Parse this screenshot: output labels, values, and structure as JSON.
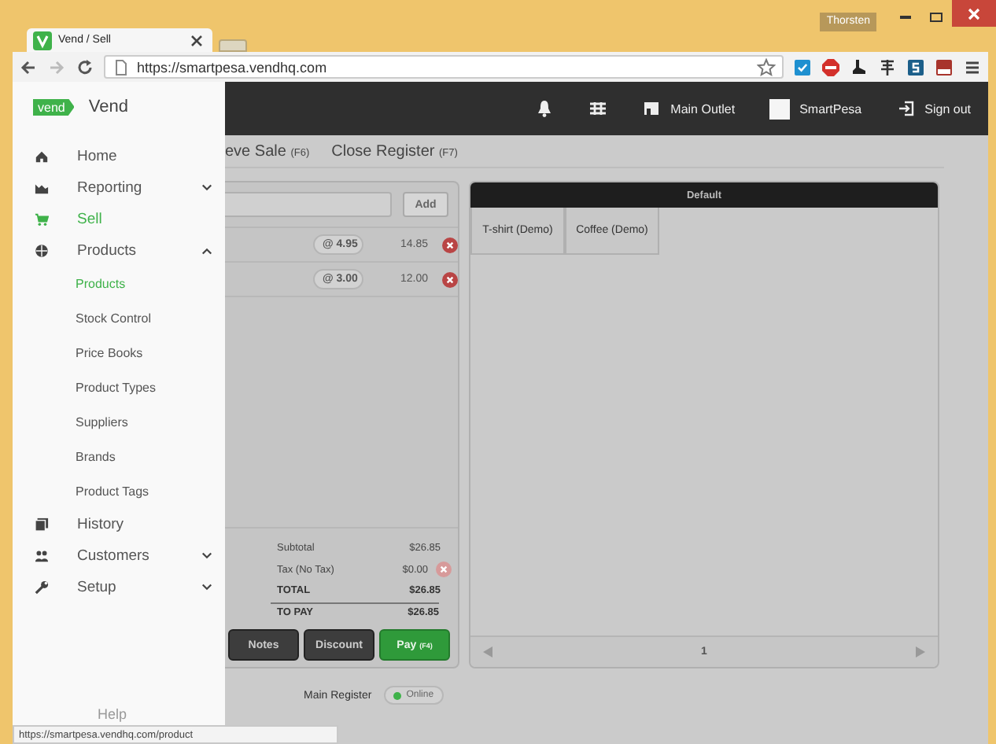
{
  "browser": {
    "tab_title": "Vend / Sell",
    "url": "https://smartpesa.vendhq.com",
    "profile": "Thorsten",
    "status_url": "https://smartpesa.vendhq.com/product"
  },
  "sidebar": {
    "logo": "vend",
    "brand": "Vend",
    "items": [
      {
        "label": "Home",
        "selected": false
      },
      {
        "label": "Reporting",
        "selected": false,
        "expanded": false
      },
      {
        "label": "Sell",
        "selected": true
      },
      {
        "label": "Products",
        "selected": false,
        "expanded": true,
        "children": [
          {
            "label": "Products",
            "selected": true
          },
          {
            "label": "Stock Control",
            "selected": false
          },
          {
            "label": "Price Books",
            "selected": false
          },
          {
            "label": "Product Types",
            "selected": false
          },
          {
            "label": "Suppliers",
            "selected": false
          },
          {
            "label": "Brands",
            "selected": false
          },
          {
            "label": "Product Tags",
            "selected": false
          }
        ]
      },
      {
        "label": "History",
        "selected": false
      },
      {
        "label": "Customers",
        "selected": false,
        "expanded": false
      },
      {
        "label": "Setup",
        "selected": false,
        "expanded": false
      }
    ],
    "help": "Help"
  },
  "topbar": {
    "outlet": "Main Outlet",
    "user": "SmartPesa",
    "sign_out": "Sign out"
  },
  "actions": [
    {
      "label": "eve Sale",
      "shortcut": "(F6)"
    },
    {
      "label": "Close Register",
      "shortcut": "(F7)"
    }
  ],
  "sale": {
    "add_button": "Add",
    "lines": [
      {
        "unit": "@ 4.95",
        "total": "14.85"
      },
      {
        "unit": "@ 3.00",
        "total": "12.00"
      }
    ],
    "totals": [
      {
        "kind": "plain",
        "label": "Subtotal",
        "value": "$26.85"
      },
      {
        "kind": "tax",
        "label": "Tax (No Tax)",
        "value": "$0.00"
      },
      {
        "kind": "total",
        "label": "TOTAL",
        "value": "$26.85"
      },
      {
        "kind": "topay",
        "label": "TO PAY",
        "value": "$26.85"
      }
    ],
    "buttons": [
      {
        "kind": "dark",
        "label": "Notes"
      },
      {
        "kind": "dark",
        "label": "Discount"
      },
      {
        "kind": "pay",
        "label": "Pay",
        "shortcut": "(F4)"
      }
    ]
  },
  "quick_keys": {
    "title": "Default",
    "tiles": [
      "T-shirt (Demo)",
      "Coffee (Demo)"
    ],
    "page": "1"
  },
  "register": {
    "name": "Main Register",
    "status": "Online"
  }
}
